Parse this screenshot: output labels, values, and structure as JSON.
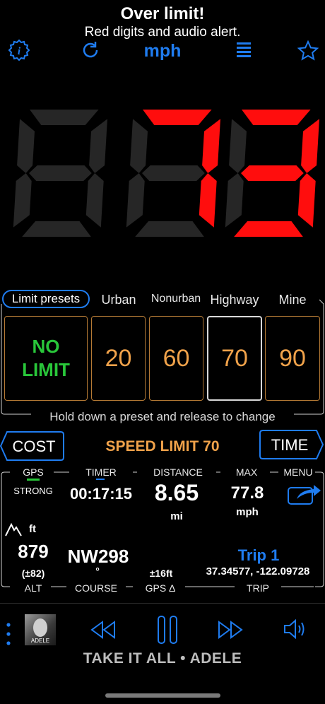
{
  "header": {
    "title": "Over limit!",
    "subtitle": "Red digits and audio alert.",
    "unit": "mph",
    "icons": [
      "info-gear-icon",
      "refresh-icon",
      "menu-lines-icon",
      "star-icon"
    ]
  },
  "speed_display": {
    "digits": [
      "8",
      "7",
      "3"
    ],
    "lit": [
      false,
      true,
      true
    ],
    "lit_color": "#ff0d0d",
    "dim_color": "#262626"
  },
  "presets": {
    "active_label": "Limit presets",
    "labels": [
      "Urban",
      "Nonurban",
      "Highway",
      "Mine"
    ],
    "no_limit_line1": "NO",
    "no_limit_line2": "LIMIT",
    "values": [
      "20",
      "60",
      "70",
      "90"
    ],
    "selected": "70",
    "hint": "Hold down a preset and release to change"
  },
  "limit_bar": {
    "cost": "COST",
    "limit_text": "SPEED LIMIT 70",
    "time": "TIME"
  },
  "stats": {
    "top_labels": [
      "GPS",
      "TIMER",
      "DISTANCE",
      "MAX",
      "MENU"
    ],
    "gps_strength": "STRONG",
    "timer": "00:17:15",
    "distance": "8.65",
    "distance_unit": "mi",
    "max": "77.8",
    "max_unit": "mph",
    "alt_unit": "ft",
    "altitude": "879",
    "alt_accuracy": "(±82)",
    "course": "NW298",
    "course_unit": "°",
    "gps_delta": "±16ft",
    "trip_name": "Trip 1",
    "coordinates": "37.34577, -122.09728",
    "bottom_labels": [
      "ALT",
      "COURSE",
      "GPS Δ",
      "TRIP"
    ]
  },
  "media": {
    "album_label": "ADELE",
    "now_playing": "TAKE IT ALL • ADELE"
  },
  "colors": {
    "accent": "#1f7cf0",
    "orange": "#f0a24a",
    "green": "#29c73a",
    "red": "#ff0d0d"
  }
}
